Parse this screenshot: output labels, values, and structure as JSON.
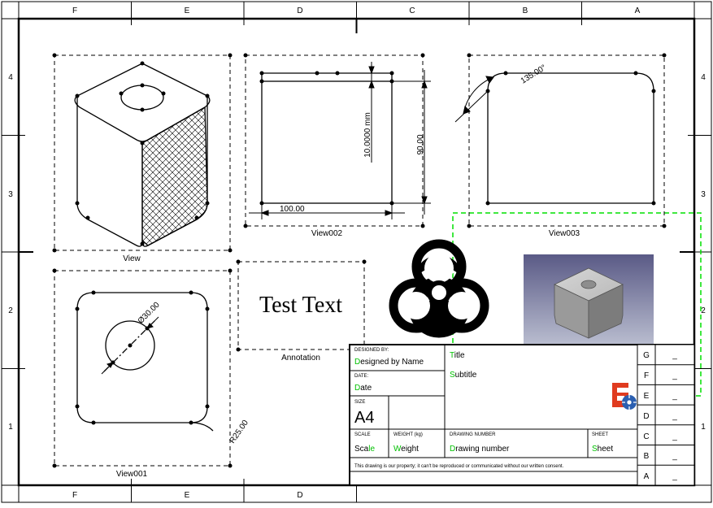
{
  "frame": {
    "cols_top": [
      "F",
      "E",
      "D",
      "C",
      "B",
      "A"
    ],
    "cols_bot": [
      "F",
      "E",
      "D"
    ],
    "rows_left": [
      "4",
      "3",
      "2",
      "1"
    ],
    "rows_right": [
      "4",
      "3",
      "2",
      "1"
    ]
  },
  "views": {
    "v_iso": "View",
    "v_001": "View001",
    "v_002": "View002",
    "v_003": "View003",
    "annot": "Annotation",
    "symbol": "Symbol",
    "image": "Image",
    "test_text": "Test Text"
  },
  "dims": {
    "d100": "100.00",
    "d90": "90.00",
    "d10mm": "10.0000 mm",
    "ang135": "135.00°",
    "dia30": "Ø30.00",
    "r25": "R25.00"
  },
  "titleblock": {
    "designed_by_h": "DESIGNED BY:",
    "designed_by": "Designed by Name",
    "date_h": "DATE:",
    "date": "Date",
    "size_h": "SIZE",
    "size": "A4",
    "scale_h": "SCALE",
    "scale": "Scale",
    "weight_h": "WEIGHT (kg)",
    "weight": "Weight",
    "dn_h": "DRAWING NUMBER",
    "dn": "Drawing number",
    "sheet_h": "SHEET",
    "sheet": "Sheet",
    "title": "Title",
    "subtitle": "Subtitle",
    "disclaimer": "This drawing is our property; it can't be reproduced or communicated without our written consent.",
    "rev_letters": [
      "G",
      "F",
      "E",
      "D",
      "C",
      "B",
      "A"
    ],
    "rev_dash": "_"
  }
}
